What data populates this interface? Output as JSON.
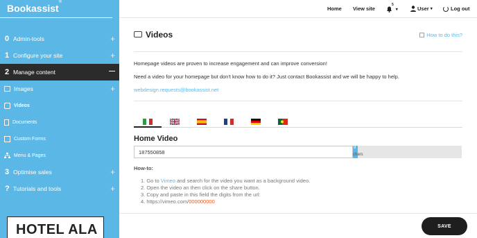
{
  "brand": {
    "name": "Bookassist",
    "mark": "®"
  },
  "sidebar": {
    "items": [
      {
        "num": "0",
        "label": "Admin-tools"
      },
      {
        "num": "1",
        "label": "Configure your site"
      },
      {
        "num": "2",
        "label": "Manage content"
      }
    ],
    "subitems": [
      {
        "label": "Images",
        "icon": "image-icon"
      },
      {
        "label": "Videos",
        "icon": "video-icon"
      },
      {
        "label": "Documents",
        "icon": "document-icon"
      },
      {
        "label": "Custom Forms",
        "icon": "form-icon"
      },
      {
        "label": "Menu & Pages",
        "icon": "sitemap-icon"
      }
    ],
    "items_bottom": [
      {
        "num": "3",
        "label": "Optimise sales"
      },
      {
        "num": "?",
        "label": "Tutorials and tools"
      }
    ],
    "hotel_logo": "HOTEL ALA"
  },
  "topnav": {
    "home": "Home",
    "view_site": "View site",
    "notifications_count": "5",
    "user": "User",
    "logout": "Log out"
  },
  "page": {
    "title": "Videos",
    "how_link": "How to do this?",
    "intro": "Homepage videos are proven to increase engagement and can improve conversion!",
    "contact": "Need a video for your homepage but don't know how to do it? Just contact Bookassist and we will be happy to help.",
    "email": "webdesign.requests@bookassist.net",
    "languages": [
      "Italian",
      "English",
      "Spanish",
      "French",
      "German",
      "Portuguese"
    ],
    "section_title": "Home Video",
    "video_value": "187550858",
    "counter_num": "9",
    "counter_label": "chars",
    "howto_title": "How-to:",
    "steps": {
      "s1_pre": "1. Go to ",
      "s1_link": "Vimeo",
      "s1_post": " and search for the video you want as a background video.",
      "s2": "2. Open the video an then click on the share button.",
      "s3": "3. Copy and paste in this field the digits from the url:",
      "s4_pre": "4. https://vimeo.com/",
      "s4_digits": "000000000"
    },
    "save": "SAVE"
  },
  "colors": {
    "sidebar": "#5bb8e6",
    "active": "#2b2b2b",
    "accent": "#5bb8e6",
    "highlight": "#e65a1f"
  }
}
